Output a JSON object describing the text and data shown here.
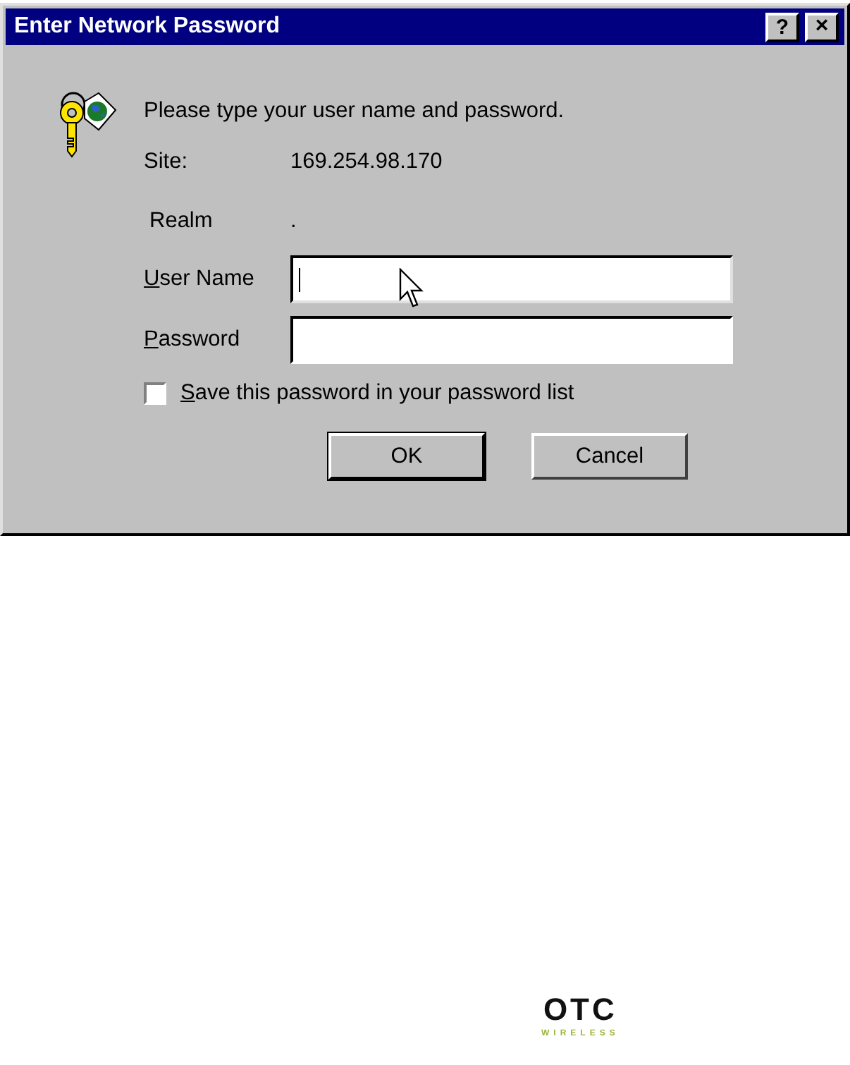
{
  "window": {
    "title": "Enter Network Password",
    "buttons": [
      {
        "kind": "help",
        "label": "?"
      },
      {
        "kind": "close",
        "label": "×"
      }
    ]
  },
  "message": "Please type your user name and password.",
  "site": {
    "label": "Site:",
    "value": "169.254.98.170"
  },
  "realm": {
    "label": "Realm",
    "value": "."
  },
  "fields": [
    {
      "label": "User Name",
      "underline_first": true,
      "focused": true
    },
    {
      "label": "Password",
      "underline_first": true,
      "focused": false
    }
  ],
  "save_password": {
    "label": "Save this password in your password list",
    "underline_first": true,
    "checked": false
  },
  "buttons": [
    {
      "label": "OK",
      "default": true
    },
    {
      "label": "Cancel",
      "default": false
    }
  ],
  "logo": {
    "name": "OTC",
    "tagline": "WIRELESS"
  }
}
